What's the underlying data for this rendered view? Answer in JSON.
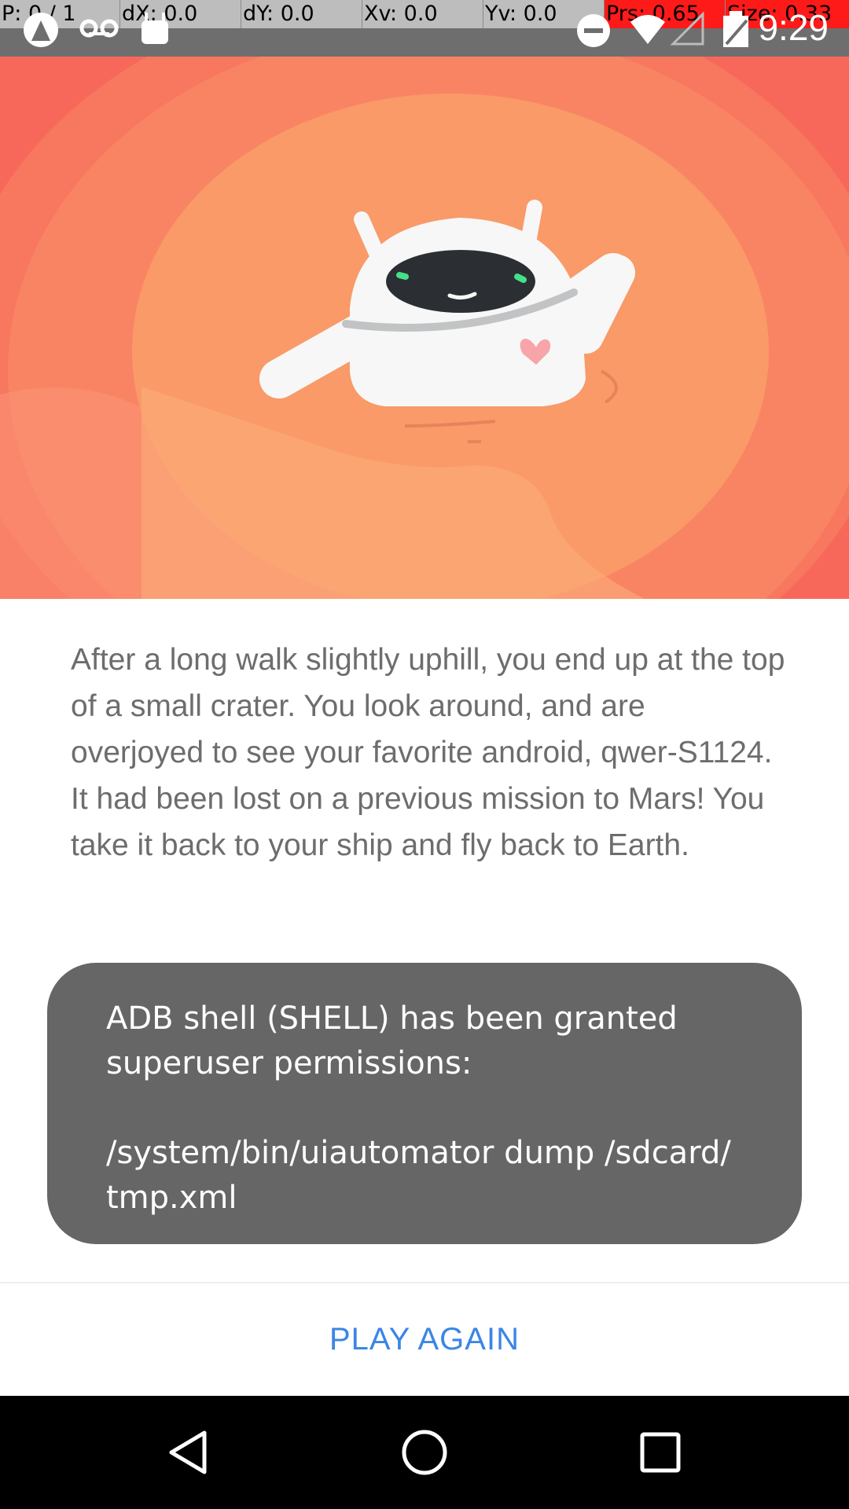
{
  "debug_overlay": {
    "pointer": "P: 0 / 1",
    "dx": "dX: 0.0",
    "dy": "dY: 0.0",
    "xv": "Xv: 0.0",
    "yv": "Yv: 0.0",
    "pressure": "Prs: 0.65",
    "size": "Size: 0.33"
  },
  "status_bar": {
    "time": "9:29",
    "left_icons": [
      "app-notification-icon",
      "voicemail-icon",
      "android-debug-icon"
    ],
    "right_icons": [
      "do-not-disturb-icon",
      "wifi-icon",
      "no-signal-icon",
      "battery-charging-icon"
    ]
  },
  "hero": {
    "illustration": "waving-android-robot-in-crater-illustration",
    "colors": {
      "background": "#f7685a",
      "crater": "#f99a68",
      "robot": "#ffffff"
    }
  },
  "story": {
    "text": "After a long walk slightly uphill, you end up at the top of a small crater. You look around, and are overjoyed to see your favorite android, qwer-S1124. It had been lost on a previous mission to Mars! You take it back to your ship and fly back to Earth."
  },
  "toast": {
    "message": "ADB shell (SHELL) has been granted\nsuperuser permissions:\n\n/system/bin/uiautomator dump /sdcard/\ntmp.xml"
  },
  "actions": {
    "play_again_label": "PLAY AGAIN"
  },
  "colors": {
    "accent": "#3b86e4",
    "toast_bg": "#666666",
    "body_text": "#6d6d6d"
  },
  "nav_bar": {
    "buttons": [
      "back-icon",
      "home-icon",
      "recents-icon"
    ]
  }
}
